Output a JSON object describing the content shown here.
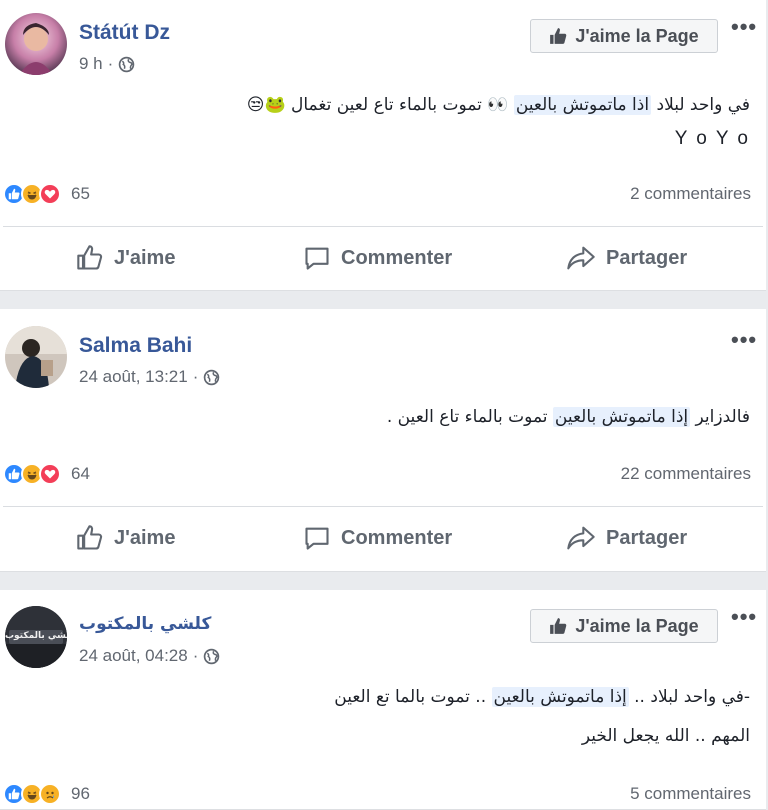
{
  "colors": {
    "name": "#385898",
    "meta": "#616770",
    "like_blue": "#2d88ff",
    "love_red": "#f33e58",
    "haha_yellow": "#f7b125",
    "highlight": "#e7f0fd"
  },
  "posts": [
    {
      "author": "Státút Dz",
      "time": "9 h",
      "privacy_icon": "globe-icon",
      "like_page_label": "J'aime la Page",
      "lines": [
        {
          "before": "في واحد لبلاد",
          "highlight": "اذا ماتموتش بالعين",
          "after": "👀 تموت بالماء تاع لعين تغمال 🐸😒"
        },
        {
          "text": "Y o Y o"
        }
      ],
      "reactions": [
        "like",
        "haha",
        "love"
      ],
      "reaction_count": "65",
      "comments": "2 commentaires",
      "actions": {
        "like": "J'aime",
        "comment": "Commenter",
        "share": "Partager"
      }
    },
    {
      "author": "Salma Bahi",
      "time": "24 août, 13:21",
      "privacy_icon": "globe-icon",
      "lines": [
        {
          "before": "فالدزاير",
          "highlight": "إذا ماتموتش بالعين",
          "after": "تموت بالماء تاع العين ."
        }
      ],
      "reactions": [
        "like",
        "haha",
        "love"
      ],
      "reaction_count": "64",
      "comments": "22 commentaires",
      "actions": {
        "like": "J'aime",
        "comment": "Commenter",
        "share": "Partager"
      }
    },
    {
      "author": "كلشي بالمكتوب",
      "time": "24 août, 04:28",
      "privacy_icon": "globe-icon",
      "like_page_label": "J'aime la Page",
      "avatar_text": "كلشي بالمكتوب",
      "lines": [
        {
          "before": "-في واحد لبلاد ..",
          "highlight": "إذا ماتموتش بالعين",
          "after": ".. تموت بالما تع العين"
        },
        {
          "text": "المهم .. الله يجعل الخير"
        }
      ],
      "reactions": [
        "like",
        "haha",
        "sad"
      ],
      "reaction_count": "96",
      "comments": "5 commentaires"
    }
  ]
}
